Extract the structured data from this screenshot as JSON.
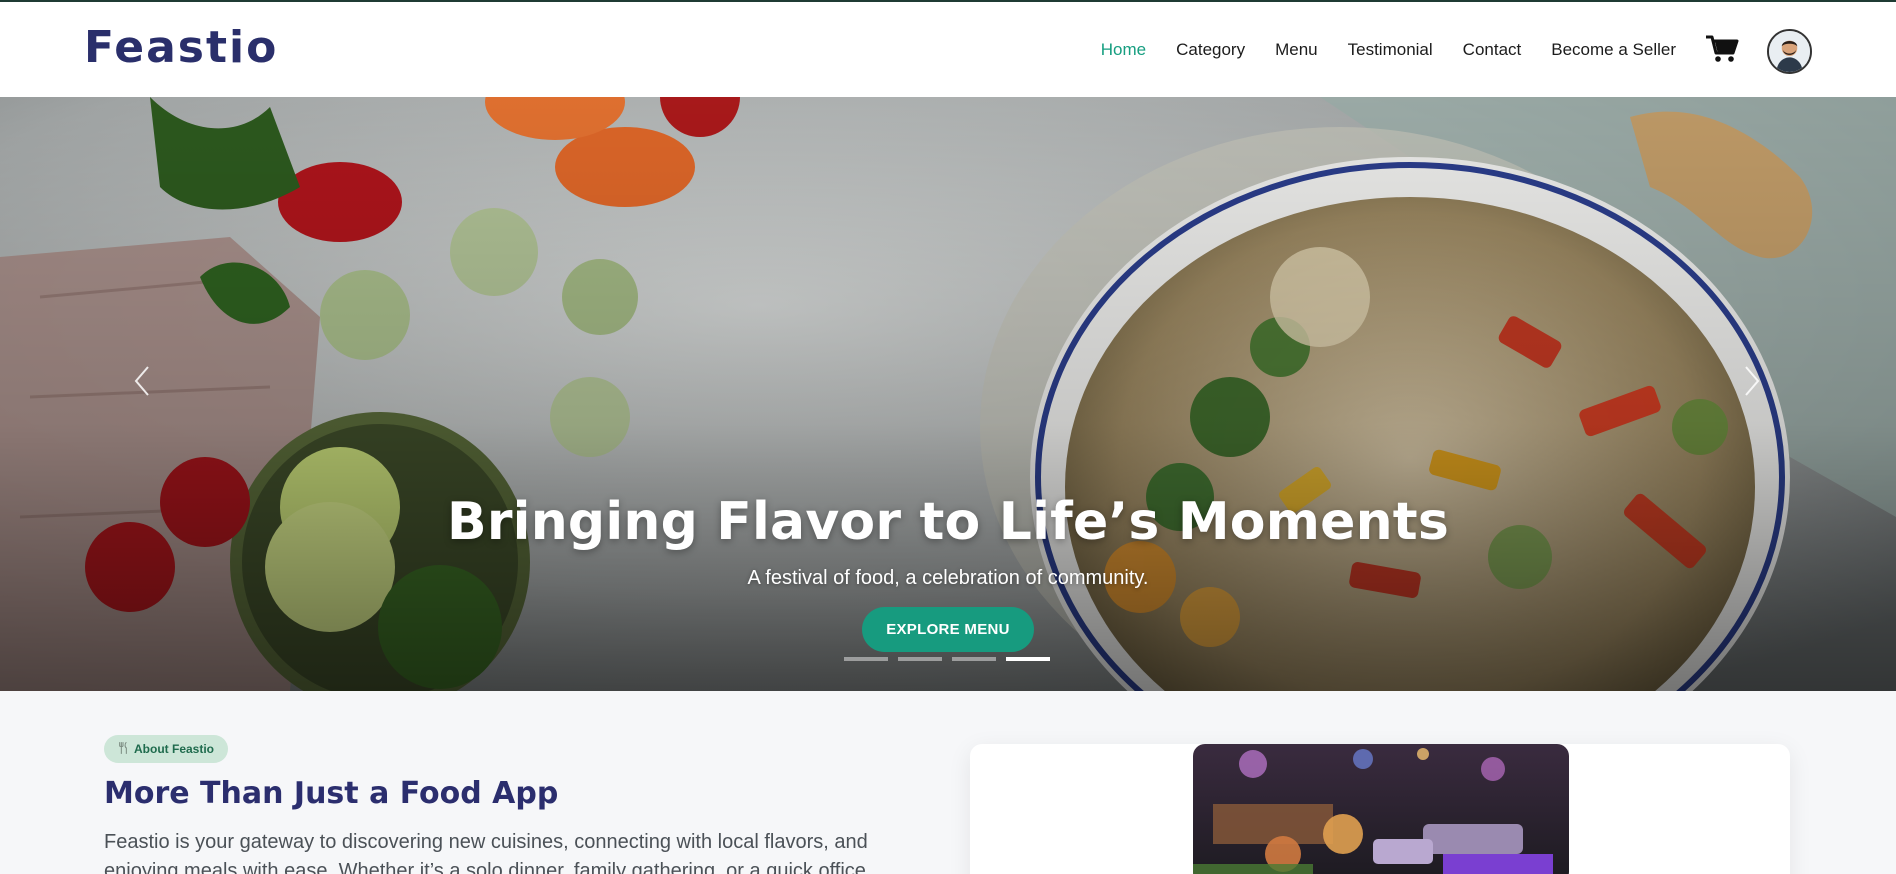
{
  "brand": {
    "name": "Feastio"
  },
  "nav": {
    "items": [
      {
        "label": "Home",
        "active": true
      },
      {
        "label": "Category",
        "active": false
      },
      {
        "label": "Menu",
        "active": false
      },
      {
        "label": "Testimonial",
        "active": false
      },
      {
        "label": "Contact",
        "active": false
      },
      {
        "label": "Become a Seller",
        "active": false
      }
    ],
    "cart_icon": "cart-icon",
    "avatar_icon": "user-avatar"
  },
  "hero": {
    "title": "Bringing Flavor to Life’s Moments",
    "subtitle": "A festival of food, a celebration of community.",
    "cta_label": "EXPLORE MENU",
    "slides_total": 4,
    "active_slide": 4
  },
  "about": {
    "badge_icon": "utensils-icon",
    "badge_label": "About Feastio",
    "title": "More Than Just a Food App",
    "text": "Feastio is your gateway to discovering new cuisines, connecting with local flavors, and enjoying meals with ease. Whether it’s a solo dinner, family gathering, or a quick office"
  },
  "colors": {
    "brand_navy": "#2a2f6b",
    "accent_green": "#179b7f",
    "badge_bg": "#cde6d8"
  }
}
